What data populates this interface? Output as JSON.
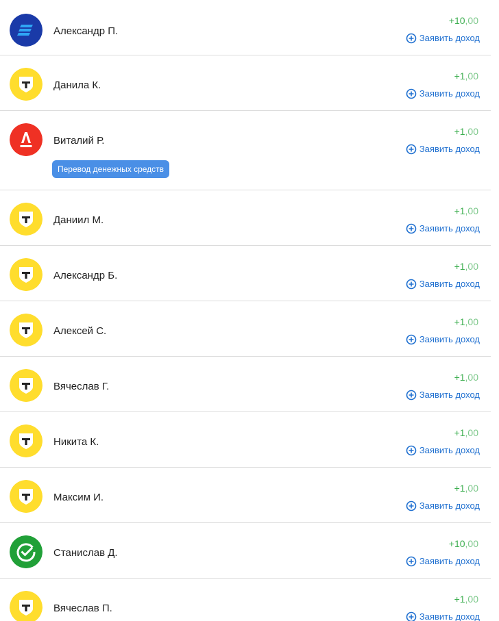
{
  "accent_color": "#1e6fd0",
  "amount_color": "#3cae4f",
  "claim_label": "Заявить доход",
  "transactions": [
    {
      "name": "Александр П.",
      "amount_int": "+10",
      "amount_dec": ",00",
      "bank_icon": "blue-bank-icon"
    },
    {
      "name": "Данила К.",
      "amount_int": "+1",
      "amount_dec": ",00",
      "bank_icon": "yellow-t-bank-icon"
    },
    {
      "name": "Виталий Р.",
      "amount_int": "+1",
      "amount_dec": ",00",
      "bank_icon": "red-a-bank-icon",
      "tag": "Перевод денежных средств"
    },
    {
      "name": "Даниил М.",
      "amount_int": "+1",
      "amount_dec": ",00",
      "bank_icon": "yellow-t-bank-icon"
    },
    {
      "name": "Александр Б.",
      "amount_int": "+1",
      "amount_dec": ",00",
      "bank_icon": "yellow-t-bank-icon"
    },
    {
      "name": "Алексей С.",
      "amount_int": "+1",
      "amount_dec": ",00",
      "bank_icon": "yellow-t-bank-icon"
    },
    {
      "name": "Вячеслав Г.",
      "amount_int": "+1",
      "amount_dec": ",00",
      "bank_icon": "yellow-t-bank-icon"
    },
    {
      "name": "Никита К.",
      "amount_int": "+1",
      "amount_dec": ",00",
      "bank_icon": "yellow-t-bank-icon"
    },
    {
      "name": "Максим И.",
      "amount_int": "+1",
      "amount_dec": ",00",
      "bank_icon": "yellow-t-bank-icon"
    },
    {
      "name": "Станислав Д.",
      "amount_int": "+10",
      "amount_dec": ",00",
      "bank_icon": "green-check-bank-icon"
    },
    {
      "name": "Вячеслав П.",
      "amount_int": "+1",
      "amount_dec": ",00",
      "bank_icon": "yellow-t-bank-icon"
    }
  ]
}
